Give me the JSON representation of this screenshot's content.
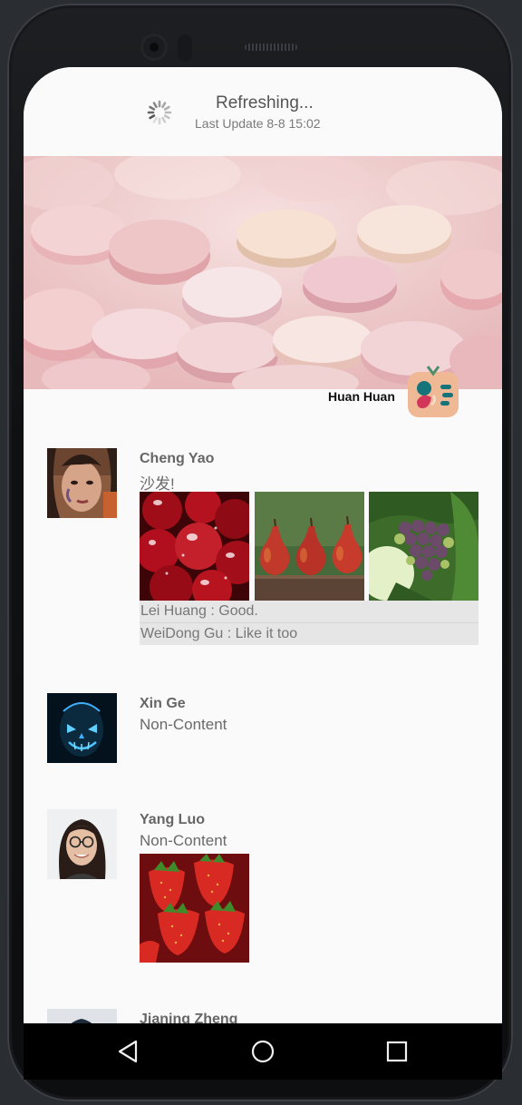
{
  "refresh": {
    "title": "Refreshing...",
    "last_update": "Last Update 8-8 15:02"
  },
  "header": {
    "owner_name": "Huan Huan"
  },
  "posts": [
    {
      "name": "Cheng Yao",
      "content": "沙发!",
      "avatar": "woman-portrait",
      "photos": [
        "cherries-photo",
        "pears-photo",
        "grapes-photo"
      ],
      "comments": [
        {
          "text": "Lei Huang : Good."
        },
        {
          "text": "WeiDong Gu : Like it too"
        }
      ]
    },
    {
      "name": "Xin Ge",
      "content": "Non-Content",
      "avatar": "glowing-skull-mask"
    },
    {
      "name": "Yang Luo",
      "content": "Non-Content",
      "avatar": "smiling-woman-glasses",
      "photos": [
        "strawberries-photo"
      ]
    },
    {
      "name": "Jianing Zheng",
      "avatar": "person-portrait"
    }
  ],
  "navbar": {
    "back_icon": "triangle-back-icon",
    "home_icon": "circle-home-icon",
    "recents_icon": "square-recents-icon"
  },
  "colors": {
    "screen_bg": "#fafafa",
    "comment_bg": "#e6e6e6",
    "name_text": "#666666"
  }
}
